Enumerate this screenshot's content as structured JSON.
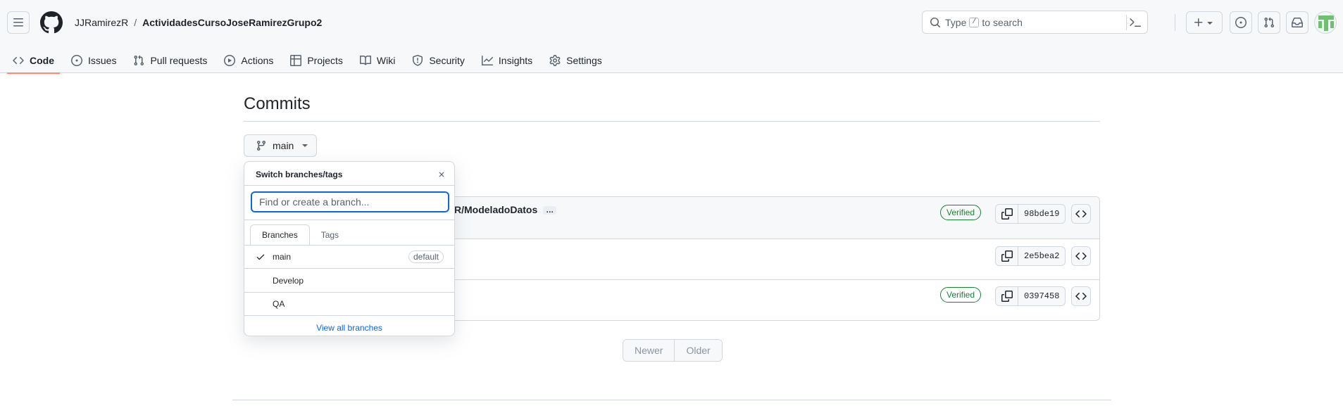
{
  "header": {
    "owner": "JJRamirezR",
    "separator": "/",
    "repo": "ActividadesCursoJoseRamirezGrupo2",
    "search": {
      "prefix": "Type",
      "key": "/",
      "suffix": "to search"
    }
  },
  "nav": {
    "items": [
      {
        "label": "Code",
        "icon": "code-icon"
      },
      {
        "label": "Issues",
        "icon": "issue-opened-icon"
      },
      {
        "label": "Pull requests",
        "icon": "git-pull-request-icon"
      },
      {
        "label": "Actions",
        "icon": "play-icon"
      },
      {
        "label": "Projects",
        "icon": "table-icon"
      },
      {
        "label": "Wiki",
        "icon": "book-icon"
      },
      {
        "label": "Security",
        "icon": "shield-icon"
      },
      {
        "label": "Insights",
        "icon": "graph-icon"
      },
      {
        "label": "Settings",
        "icon": "gear-icon"
      }
    ]
  },
  "main": {
    "title": "Commits",
    "branch": "main"
  },
  "commits": [
    {
      "title_visible": "R/ModeladoDatos",
      "ellipsis": "…",
      "verified": "Verified",
      "sha": "98bde19"
    },
    {
      "title_visible": "",
      "ellipsis": "",
      "verified": "",
      "sha": "2e5bea2"
    },
    {
      "title_visible": "",
      "ellipsis": "",
      "verified": "Verified",
      "sha": "0397458"
    }
  ],
  "pagination": {
    "newer": "Newer",
    "older": "Older"
  },
  "dropdown": {
    "header": "Switch branches/tags",
    "placeholder": "Find or create a branch...",
    "tabs": [
      "Branches",
      "Tags"
    ],
    "branches": [
      {
        "name": "main",
        "selected": true,
        "badge": "default"
      },
      {
        "name": "Develop",
        "selected": false,
        "badge": ""
      },
      {
        "name": "QA",
        "selected": false,
        "badge": ""
      }
    ],
    "view_all": "View all branches"
  },
  "colors": {
    "accent": "#0969da",
    "verified": "#1a7f37",
    "selected_tab_underline": "#fd8c73",
    "border": "#d0d7de"
  }
}
